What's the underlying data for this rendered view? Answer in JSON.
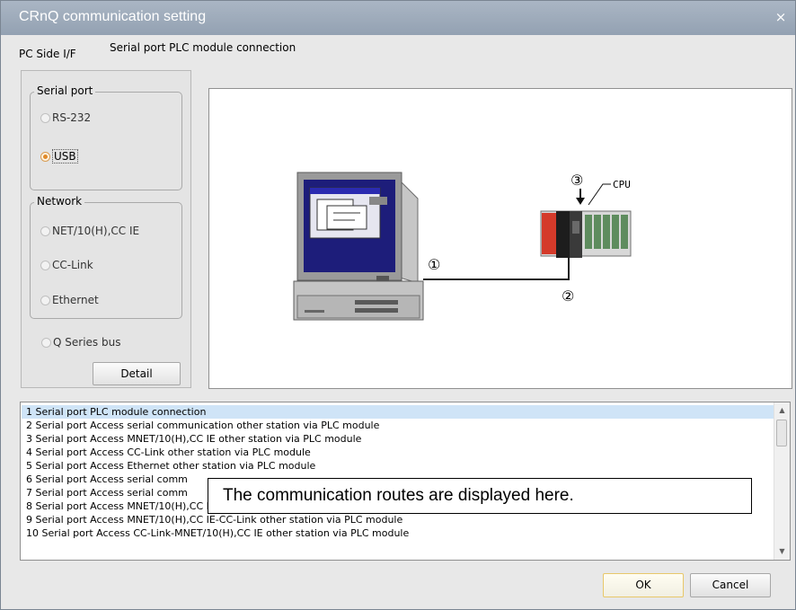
{
  "window": {
    "title": "CRnQ communication setting",
    "close_glyph": "×"
  },
  "pc_side_label": "PC Side I/F",
  "connection_label": "Serial port PLC module connection",
  "serial_group": {
    "title": "Serial port",
    "options": [
      {
        "label": "RS-232",
        "selected": false
      },
      {
        "label": "USB",
        "selected": true
      }
    ]
  },
  "network_group": {
    "title": "Network",
    "options": [
      {
        "label": "NET/10(H),CC IE",
        "selected": false
      },
      {
        "label": "CC-Link",
        "selected": false
      },
      {
        "label": "Ethernet",
        "selected": false
      }
    ]
  },
  "q_series_bus": {
    "label": "Q Series bus",
    "selected": false
  },
  "detail_button": "Detail",
  "diagram": {
    "marker_1": "①",
    "marker_2": "②",
    "marker_3": "③",
    "cpu_label": "CPU"
  },
  "routes": [
    "1 Serial port PLC module connection",
    "2 Serial port Access serial communication other station via PLC module",
    "3 Serial port Access MNET/10(H),CC IE other station via PLC module",
    "4 Serial port Access CC-Link other station via PLC module",
    "5 Serial port Access Ethernet other station via PLC module",
    "6 Serial port Access serial comm",
    "7 Serial port Access serial comm",
    "8 Serial port Access MNET/10(H),CC IE-serial communication other station via PLC module",
    "9 Serial port Access MNET/10(H),CC IE-CC-Link other station via PLC module",
    "10 Serial port Access CC-Link-MNET/10(H),CC IE other station via PLC module"
  ],
  "selected_route_index": 0,
  "callout_text": "The communication routes are displayed here.",
  "buttons": {
    "ok": "OK",
    "cancel": "Cancel"
  },
  "colors": {
    "selection": "#cfe4f7",
    "radio_selected": "#e08a2a",
    "title_bar": "#9aa8b8"
  }
}
